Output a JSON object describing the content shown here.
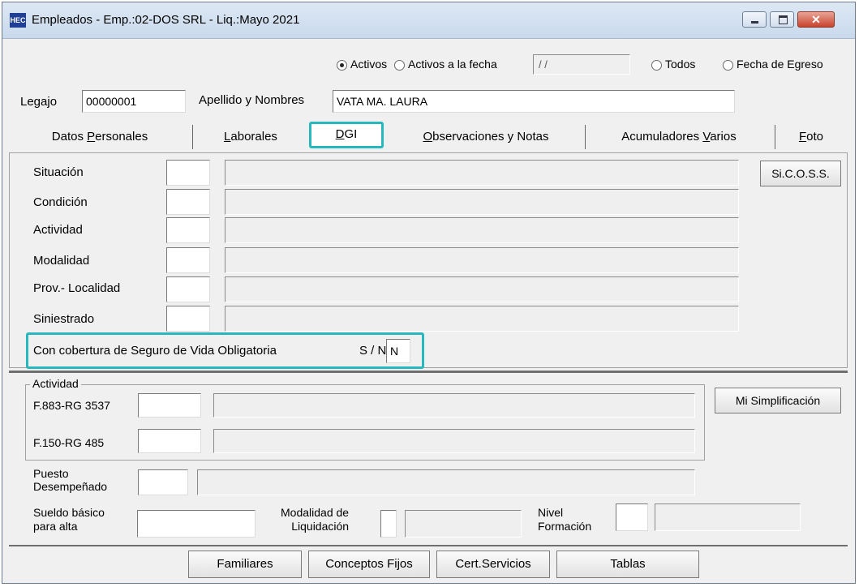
{
  "window": {
    "title": "Empleados - Emp.:02-DOS SRL - Liq.:Mayo 2021",
    "icon_text": "HEC"
  },
  "filter": {
    "activos": "Activos",
    "activos_fecha": "Activos a la fecha",
    "fecha_value": " / /",
    "todos": "Todos",
    "fecha_egreso": "Fecha de Egreso",
    "selected": "Activos"
  },
  "employee": {
    "legajo_label": "Legajo",
    "legajo_value": "00000001",
    "nombre_label": "Apellido y Nombres",
    "nombre_value": "VATA MA. LAURA"
  },
  "tabs": {
    "datos_personales": {
      "pre": "Datos ",
      "u": "P",
      "post": "ersonales"
    },
    "laborales": {
      "pre": "",
      "u": "L",
      "post": "aborales"
    },
    "dgi": {
      "pre": "",
      "u": "D",
      "post": "GI"
    },
    "observaciones": {
      "pre": "",
      "u": "O",
      "post": "bservaciones y Notas"
    },
    "acumuladores": {
      "pre": "Acumuladores ",
      "u": "V",
      "post": "arios"
    },
    "foto": {
      "pre": "",
      "u": "F",
      "post": "oto"
    },
    "active": "DGI"
  },
  "dgi": {
    "situacion": "Situación",
    "condicion": "Condición",
    "actividad": "Actividad",
    "modalidad": "Modalidad",
    "prov_localidad": "Prov.- Localidad",
    "siniestrado": "Siniestrado",
    "sicoss_button": "Si.C.O.S.S.",
    "seguro_label": "Con cobertura de Seguro de Vida Obligatoria",
    "sn_label": "S / N",
    "seguro_value": "N"
  },
  "lower": {
    "actividad_group": "Actividad",
    "f883": "F.883-RG 3537",
    "f150": "F.150-RG 485",
    "mi_simplificacion": "Mi Simplificación",
    "puesto_1": "Puesto",
    "puesto_2": "Desempeñado",
    "sueldo_1": "Sueldo básico",
    "sueldo_2": "para alta",
    "modalidad_1": "Modalidad de",
    "modalidad_2": "Liquidación",
    "nivel_1": "Nivel",
    "nivel_2": "Formación"
  },
  "buttons": {
    "familiares": "Familiares",
    "conceptos_fijos": "Conceptos Fijos",
    "cert_servicios": "Cert.Servicios",
    "tablas": "Tablas"
  },
  "colors": {
    "highlight": "#26b8bd",
    "titlebar": "#c9d9ec",
    "background": "#f0f0f0"
  }
}
